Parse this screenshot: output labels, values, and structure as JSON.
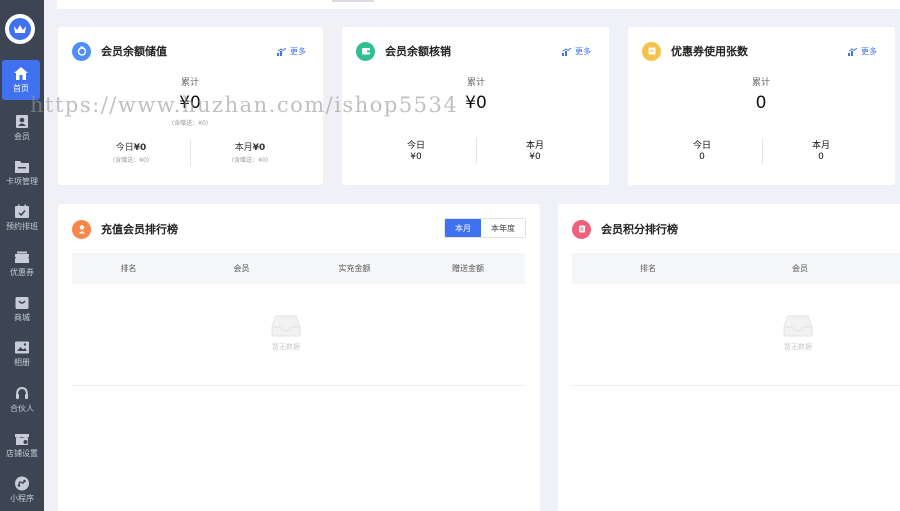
{
  "sidebar": {
    "logo_icon": "crown-icon",
    "items": [
      {
        "label": "首页",
        "icon": "home-icon",
        "active": true
      },
      {
        "label": "会员",
        "icon": "member-icon"
      },
      {
        "label": "卡项管理",
        "icon": "folder-icon"
      },
      {
        "label": "预约排班",
        "icon": "calendar-check-icon"
      },
      {
        "label": "优惠券",
        "icon": "coupon-icon"
      },
      {
        "label": "商城",
        "icon": "shop-icon"
      },
      {
        "label": "相册",
        "icon": "album-icon"
      },
      {
        "label": "合伙人",
        "icon": "headset-icon"
      },
      {
        "label": "店铺设置",
        "icon": "store-settings-icon"
      },
      {
        "label": "小程序",
        "icon": "miniprogram-icon"
      }
    ]
  },
  "cards": {
    "balance_stored": {
      "title": "会员余额储值",
      "more": "更多",
      "total_label": "累计",
      "total_value": "¥0",
      "total_note": "(含赠送：¥0)",
      "today_label": "今日",
      "today_value": "¥0",
      "today_note": "(含赠送：¥0)",
      "month_label": "本月",
      "month_value": "¥0",
      "month_note": "(含赠送：¥0)"
    },
    "balance_used": {
      "title": "会员余额核销",
      "more": "更多",
      "total_label": "累计",
      "total_value": "¥0",
      "today_label": "今日",
      "today_value": "¥0",
      "month_label": "本月",
      "month_value": "¥0"
    },
    "coupon_used": {
      "title": "优惠券使用张数",
      "more": "更多",
      "total_label": "累计",
      "total_value": "0",
      "today_label": "今日",
      "today_value": "0",
      "month_label": "本月",
      "month_value": "0"
    }
  },
  "recharge_ranking": {
    "title": "充值会员排行榜",
    "tabs": [
      "本月",
      "本年度"
    ],
    "columns": [
      "排名",
      "会员",
      "实充金额",
      "赠送金额"
    ],
    "empty_text": "暂无数据"
  },
  "points_ranking": {
    "title": "会员积分排行榜",
    "columns": [
      "排名",
      "会员"
    ],
    "empty_text": "暂无数据"
  },
  "watermark": "https://www.huzhan.com/ishop5534",
  "colors": {
    "sidebar_bg": "#3d4553",
    "accent": "#3f71f0",
    "icon_blue": "#4f8ef7",
    "icon_green": "#2fc18b",
    "icon_yellow": "#f7c24a",
    "icon_orange": "#f7884a",
    "icon_pink": "#f2607a"
  }
}
